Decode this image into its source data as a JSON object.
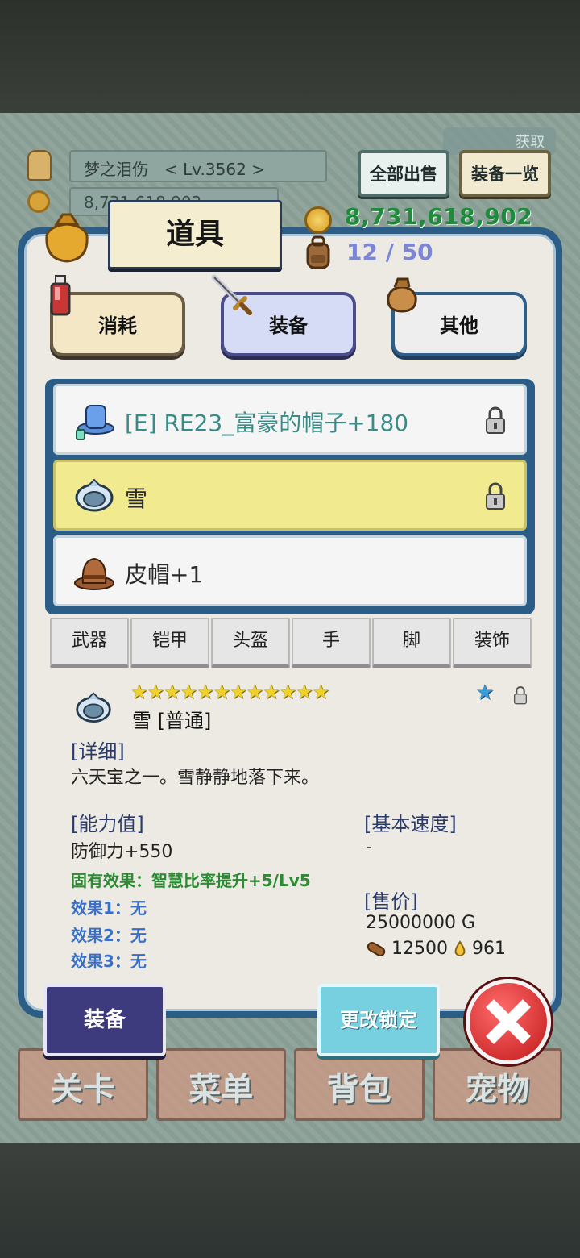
{
  "player": {
    "name_level": "梦之泪伤　< Lv.3562 >",
    "gold_behind": "8,731,618,902",
    "acquire_label": "获取"
  },
  "header": {
    "sell_all": "全部出售",
    "equip_list": "装备一览",
    "title": "道具",
    "gold": "8,731,618,902",
    "capacity": "12 / 50"
  },
  "categories": {
    "consume": "消耗",
    "equip": "装备",
    "other": "其他"
  },
  "items": [
    {
      "name": "[E] RE23_富豪的帽子+180",
      "locked": true,
      "icon": "top-hat-icon"
    },
    {
      "name": "雪",
      "locked": true,
      "selected": true,
      "icon": "snow-helmet-icon"
    },
    {
      "name": "皮帽+1",
      "locked": false,
      "icon": "leather-hat-icon"
    }
  ],
  "sub_tabs": [
    "武器",
    "铠甲",
    "头盔",
    "手",
    "脚",
    "装饰"
  ],
  "detail": {
    "stars": "★★★★★★★★★★★★",
    "name": "雪 [普通]",
    "desc_title": "[详细]",
    "desc": "六天宝之一。雪静静地落下来。",
    "stat_title": "[能力值]",
    "stat": "防御力+550",
    "inherent": "固有效果：智慧比率提升+5/Lv5",
    "effect1": "效果1：无",
    "effect2": "效果2：无",
    "effect3": "效果3：无",
    "speed_title": "[基本速度]",
    "speed": "-",
    "price_title": "[售价]",
    "price": "25000000 G",
    "material_wood": "12500",
    "material_drop": "961"
  },
  "actions": {
    "equip": "装备",
    "change_lock": "更改锁定"
  },
  "nav": [
    "关卡",
    "菜单",
    "背包",
    "宠物"
  ],
  "colors": {
    "panel_border": "#2c5d86",
    "selected_row": "#f2ea8f",
    "gold_text": "#1f8a3c",
    "capacity_text": "#7d86d6"
  }
}
